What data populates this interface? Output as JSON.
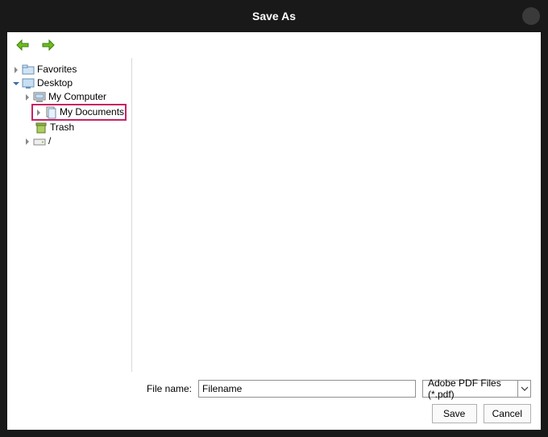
{
  "title": "Save As",
  "tree": {
    "favorites": "Favorites",
    "desktop": "Desktop",
    "my_computer": "My Computer",
    "my_documents": "My Documents",
    "trash": "Trash",
    "root": "/"
  },
  "file": {
    "label": "File name:",
    "name": "Filename",
    "type": "Adobe PDF Files (*.pdf)"
  },
  "buttons": {
    "save": "Save",
    "cancel": "Cancel"
  }
}
